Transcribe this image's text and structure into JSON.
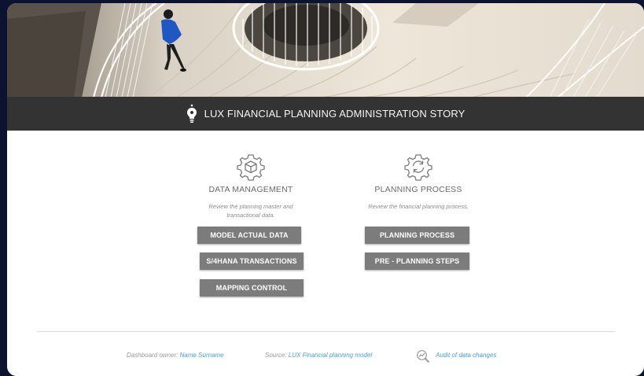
{
  "story": {
    "title": "LUX FINANCIAL PLANNING ADMINISTRATION STORY"
  },
  "sections": [
    {
      "icon": "gear-cube-icon",
      "heading": "DATA MANAGEMENT",
      "description": "Review the planning master and transactional data.",
      "buttons": [
        "MODEL ACTUAL DATA",
        "S/4HANA TRANSACTIONS",
        "MAPPING CONTROL"
      ]
    },
    {
      "icon": "refresh-gear-icon",
      "heading": "PLANNING PROCESS",
      "description": "Review the financial planning process.",
      "buttons": [
        "PLANNING PROCESS",
        "PRE - PLANNING STEPS"
      ]
    }
  ],
  "footer": {
    "owner_label": "Dashboard owner:",
    "owner_value": "Name Surname",
    "source_label": "Source:",
    "source_value": "LUX Financial planning model",
    "audit_link": "Audit of data changes",
    "audit_icon": "magnifier-chart-icon"
  },
  "colors": {
    "title_bar": "#333333",
    "button": "#7c7c7c",
    "link": "#4a9fd8",
    "background": "#0b1330"
  }
}
